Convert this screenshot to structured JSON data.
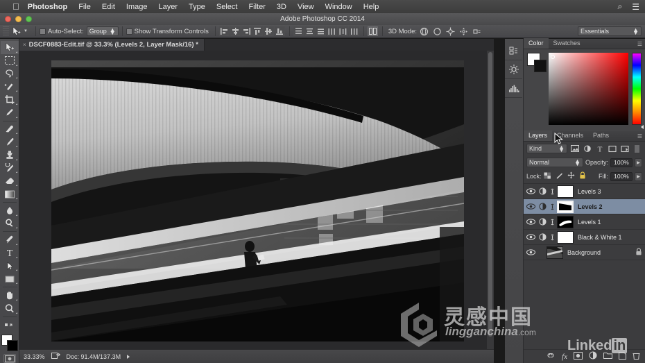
{
  "macmenu": {
    "apple": "",
    "items": [
      {
        "label": "Photoshop",
        "bold": true
      },
      {
        "label": "File"
      },
      {
        "label": "Edit"
      },
      {
        "label": "Image"
      },
      {
        "label": "Layer"
      },
      {
        "label": "Type"
      },
      {
        "label": "Select"
      },
      {
        "label": "Filter"
      },
      {
        "label": "3D"
      },
      {
        "label": "View"
      },
      {
        "label": "Window"
      },
      {
        "label": "Help"
      }
    ],
    "right": [
      {
        "name": "spotlight-search-icon",
        "glyph": "⌕"
      },
      {
        "name": "notification-center-icon",
        "glyph": "☰"
      }
    ]
  },
  "titlebar": {
    "title": "Adobe Photoshop CC 2014"
  },
  "options": {
    "tool_name": "move-tool",
    "auto_select_label": "Auto-Select:",
    "auto_select_value": "Group",
    "show_transform_label": "Show Transform Controls",
    "three_d_label": "3D Mode:",
    "workspace": "Essentials"
  },
  "document": {
    "tab_title": "DSCF0883-Edit.tif @ 33.3% (Levels 2, Layer Mask/16) *",
    "close_glyph": "×"
  },
  "status": {
    "zoom": "33.33%",
    "doc": "Doc: 91.4M/137.3M"
  },
  "tools": [
    {
      "name": "move-tool",
      "selected": true
    },
    {
      "name": "rectangular-marquee-tool"
    },
    {
      "name": "lasso-tool"
    },
    {
      "name": "quick-selection-tool"
    },
    {
      "name": "crop-tool"
    },
    {
      "name": "eyedropper-tool"
    },
    {
      "name": "spot-healing-brush-tool"
    },
    {
      "name": "brush-tool"
    },
    {
      "name": "clone-stamp-tool"
    },
    {
      "name": "history-brush-tool"
    },
    {
      "name": "eraser-tool"
    },
    {
      "name": "gradient-tool"
    },
    {
      "name": "blur-tool"
    },
    {
      "name": "dodge-tool"
    },
    {
      "name": "pen-tool"
    },
    {
      "name": "horizontal-type-tool"
    },
    {
      "name": "path-selection-tool"
    },
    {
      "name": "rectangle-shape-tool"
    },
    {
      "name": "hand-tool"
    },
    {
      "name": "zoom-tool"
    }
  ],
  "dock_rail": [
    {
      "name": "history-panel-icon"
    },
    {
      "name": "adjustments-panel-icon"
    },
    {
      "name": "histogram-panel-icon"
    }
  ],
  "color_panel": {
    "tabs": [
      {
        "label": "Color",
        "active": true
      },
      {
        "label": "Swatches",
        "active": false
      }
    ],
    "foreground_color": "#ffffff",
    "background_color": "#000000",
    "picker_hue": "#ff0000"
  },
  "layers_panel": {
    "tabs": [
      {
        "label": "Layers",
        "active": true
      },
      {
        "label": "Channels",
        "active": false
      },
      {
        "label": "Paths",
        "active": false
      }
    ],
    "filter_label": "Kind",
    "blend_mode": "Normal",
    "opacity_label": "Opacity:",
    "opacity_value": "100%",
    "lock_label": "Lock:",
    "fill_label": "Fill:",
    "fill_value": "100%",
    "layers": [
      {
        "name": "Levels 3",
        "selected": false,
        "locked": false,
        "kind": "adjustment",
        "mask": "mostly-white"
      },
      {
        "name": "Levels 2",
        "selected": true,
        "locked": false,
        "kind": "adjustment",
        "mask": "black-wedge"
      },
      {
        "name": "Levels 1",
        "selected": false,
        "locked": false,
        "kind": "adjustment",
        "mask": "white-wedge"
      },
      {
        "name": "Black & White 1",
        "selected": false,
        "locked": false,
        "kind": "adjustment",
        "mask": "white"
      },
      {
        "name": "Background",
        "selected": false,
        "locked": true,
        "kind": "image",
        "mask": "photo"
      }
    ],
    "footer_icons": [
      {
        "name": "link-layers-icon"
      },
      {
        "name": "add-layer-style-icon",
        "glyph": "fx"
      },
      {
        "name": "add-layer-mask-icon"
      },
      {
        "name": "new-adjustment-layer-icon"
      },
      {
        "name": "new-group-icon"
      },
      {
        "name": "new-layer-icon"
      },
      {
        "name": "delete-layer-icon"
      }
    ]
  },
  "watermarks": {
    "chinese": "灵感中国",
    "url_main": "lingganchina",
    "url_tld": ".com",
    "linkedin_text": "Linked",
    "linkedin_badge": "in"
  }
}
